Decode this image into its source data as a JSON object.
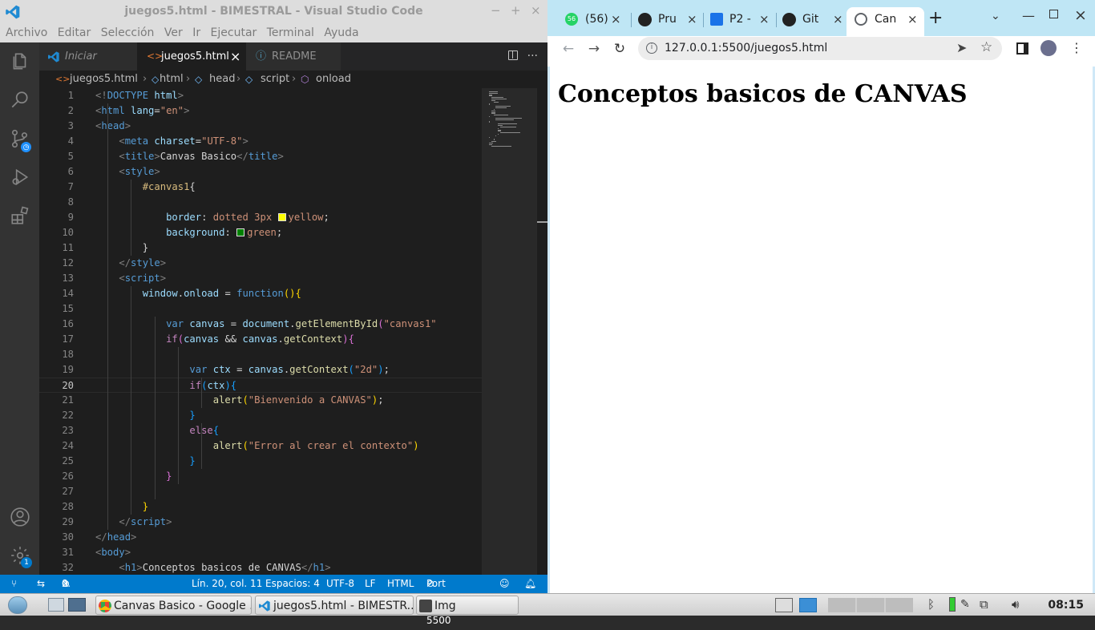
{
  "vscode": {
    "title": "juegos5.html - BIMESTRAL - Visual Studio Code",
    "window_controls": [
      "−",
      "+",
      "×"
    ],
    "menu": [
      "Archivo",
      "Editar",
      "Selección",
      "Ver",
      "Ir",
      "Ejecutar",
      "Terminal",
      "Ayuda"
    ],
    "tabs": [
      {
        "label": "Iniciar",
        "icon": "vscode-icon",
        "active": false
      },
      {
        "label": "juegos5.html",
        "icon": "html-icon",
        "active": true,
        "close": "×"
      },
      {
        "label": "README",
        "icon": "info-icon",
        "active": false
      }
    ],
    "tab_actions": {
      "split": "split-editor-icon",
      "more": "···"
    },
    "breadcrumb": [
      "juegos5.html",
      "html",
      "head",
      "script",
      "onload"
    ],
    "current_line": 20,
    "activity_badge": "1",
    "status": {
      "branch_icon": "remote-icon",
      "errors": "0",
      "warnings": "0",
      "position": "Lín. 20, col. 11",
      "spaces": "Espacios: 4",
      "encoding": "UTF-8",
      "eol": "LF",
      "language": "HTML",
      "port": "Port : 5500"
    }
  },
  "code_lines": [
    [
      {
        "t": "<!",
        "c": "t-tag"
      },
      {
        "t": "DOCTYPE",
        "c": "t-name"
      },
      {
        "t": " html",
        "c": "t-attr"
      },
      {
        "t": ">",
        "c": "t-tag"
      }
    ],
    [
      {
        "t": "<",
        "c": "t-tag"
      },
      {
        "t": "html",
        "c": "t-name"
      },
      {
        "t": " lang",
        "c": "t-attr"
      },
      {
        "t": "=",
        "c": "t-pun"
      },
      {
        "t": "\"en\"",
        "c": "t-str"
      },
      {
        "t": ">",
        "c": "t-tag"
      }
    ],
    [
      {
        "t": "<",
        "c": "t-tag"
      },
      {
        "t": "head",
        "c": "t-name"
      },
      {
        "t": ">",
        "c": "t-tag"
      }
    ],
    [
      {
        "t": "    "
      },
      {
        "t": "<",
        "c": "t-tag"
      },
      {
        "t": "meta",
        "c": "t-name"
      },
      {
        "t": " charset",
        "c": "t-attr"
      },
      {
        "t": "=",
        "c": "t-pun"
      },
      {
        "t": "\"UTF-8\"",
        "c": "t-str"
      },
      {
        "t": ">",
        "c": "t-tag"
      }
    ],
    [
      {
        "t": "    "
      },
      {
        "t": "<",
        "c": "t-tag"
      },
      {
        "t": "title",
        "c": "t-name"
      },
      {
        "t": ">",
        "c": "t-tag"
      },
      {
        "t": "Canvas Basico",
        "c": "t-pun"
      },
      {
        "t": "</",
        "c": "t-tag"
      },
      {
        "t": "title",
        "c": "t-name"
      },
      {
        "t": ">",
        "c": "t-tag"
      }
    ],
    [
      {
        "t": "    "
      },
      {
        "t": "<",
        "c": "t-tag"
      },
      {
        "t": "style",
        "c": "t-name"
      },
      {
        "t": ">",
        "c": "t-tag"
      }
    ],
    [
      {
        "t": "        "
      },
      {
        "t": "#canvas1",
        "c": "t-css-sel"
      },
      {
        "t": "{",
        "c": "t-pun"
      }
    ],
    [
      {
        "t": ""
      }
    ],
    [
      {
        "t": "            "
      },
      {
        "t": "border",
        "c": "t-css-prop"
      },
      {
        "t": ": ",
        "c": "t-pun"
      },
      {
        "t": "dotted 3px ",
        "c": "t-css-val"
      },
      {
        "sw": "#ffff00"
      },
      {
        "t": "yellow",
        "c": "t-css-val"
      },
      {
        "t": ";",
        "c": "t-pun"
      }
    ],
    [
      {
        "t": "            "
      },
      {
        "t": "background",
        "c": "t-css-prop"
      },
      {
        "t": ": ",
        "c": "t-pun"
      },
      {
        "sw": "#008000"
      },
      {
        "t": "green",
        "c": "t-css-val"
      },
      {
        "t": ";",
        "c": "t-pun"
      }
    ],
    [
      {
        "t": "        "
      },
      {
        "t": "}",
        "c": "t-pun"
      }
    ],
    [
      {
        "t": "    "
      },
      {
        "t": "</",
        "c": "t-tag"
      },
      {
        "t": "style",
        "c": "t-name"
      },
      {
        "t": ">",
        "c": "t-tag"
      }
    ],
    [
      {
        "t": "    "
      },
      {
        "t": "<",
        "c": "t-tag"
      },
      {
        "t": "script",
        "c": "t-name"
      },
      {
        "t": ">",
        "c": "t-tag"
      }
    ],
    [
      {
        "t": "        "
      },
      {
        "t": "window",
        "c": "t-var"
      },
      {
        "t": ".",
        "c": "t-pun"
      },
      {
        "t": "onload",
        "c": "t-var"
      },
      {
        "t": " = ",
        "c": "t-pun"
      },
      {
        "t": "function",
        "c": "t-kw"
      },
      {
        "t": "()",
        "c": "t-brk"
      },
      {
        "t": "{",
        "c": "t-brk"
      }
    ],
    [
      {
        "t": ""
      }
    ],
    [
      {
        "t": "            "
      },
      {
        "t": "var",
        "c": "t-kw"
      },
      {
        "t": " canvas",
        "c": "t-var"
      },
      {
        "t": " = ",
        "c": "t-pun"
      },
      {
        "t": "document",
        "c": "t-var"
      },
      {
        "t": ".",
        "c": "t-pun"
      },
      {
        "t": "getElementById",
        "c": "t-fn"
      },
      {
        "t": "(",
        "c": "t-brk2"
      },
      {
        "t": "\"canvas1\"",
        "c": "t-str"
      }
    ],
    [
      {
        "t": "            "
      },
      {
        "t": "if",
        "c": "t-ctrl"
      },
      {
        "t": "(",
        "c": "t-brk2"
      },
      {
        "t": "canvas",
        "c": "t-var"
      },
      {
        "t": " && ",
        "c": "t-pun"
      },
      {
        "t": "canvas",
        "c": "t-var"
      },
      {
        "t": ".",
        "c": "t-pun"
      },
      {
        "t": "getContext",
        "c": "t-fn"
      },
      {
        "t": ")",
        "c": "t-brk2"
      },
      {
        "t": "{",
        "c": "t-brk2"
      }
    ],
    [
      {
        "t": ""
      }
    ],
    [
      {
        "t": "                "
      },
      {
        "t": "var",
        "c": "t-kw"
      },
      {
        "t": " ctx",
        "c": "t-var"
      },
      {
        "t": " = ",
        "c": "t-pun"
      },
      {
        "t": "canvas",
        "c": "t-var"
      },
      {
        "t": ".",
        "c": "t-pun"
      },
      {
        "t": "getContext",
        "c": "t-fn"
      },
      {
        "t": "(",
        "c": "t-brk3"
      },
      {
        "t": "\"2d\"",
        "c": "t-str"
      },
      {
        "t": ")",
        "c": "t-brk3"
      },
      {
        "t": ";",
        "c": "t-pun"
      }
    ],
    [
      {
        "t": "                "
      },
      {
        "t": "if",
        "c": "t-ctrl"
      },
      {
        "t": "(",
        "c": "t-brk3"
      },
      {
        "t": "ctx",
        "c": "t-var"
      },
      {
        "t": ")",
        "c": "t-brk3"
      },
      {
        "t": "{",
        "c": "t-brk3"
      }
    ],
    [
      {
        "t": "                    "
      },
      {
        "t": "alert",
        "c": "t-fn"
      },
      {
        "t": "(",
        "c": "t-brk"
      },
      {
        "t": "\"Bienvenido a CANVAS\"",
        "c": "t-str"
      },
      {
        "t": ")",
        "c": "t-brk"
      },
      {
        "t": ";",
        "c": "t-pun"
      }
    ],
    [
      {
        "t": "                "
      },
      {
        "t": "}",
        "c": "t-brk3"
      }
    ],
    [
      {
        "t": "                "
      },
      {
        "t": "else",
        "c": "t-ctrl"
      },
      {
        "t": "{",
        "c": "t-brk3"
      }
    ],
    [
      {
        "t": "                    "
      },
      {
        "t": "alert",
        "c": "t-fn"
      },
      {
        "t": "(",
        "c": "t-brk"
      },
      {
        "t": "\"Error al crear el contexto\"",
        "c": "t-str"
      },
      {
        "t": ")",
        "c": "t-brk"
      }
    ],
    [
      {
        "t": "                "
      },
      {
        "t": "}",
        "c": "t-brk3"
      }
    ],
    [
      {
        "t": "            "
      },
      {
        "t": "}",
        "c": "t-brk2"
      }
    ],
    [
      {
        "t": ""
      }
    ],
    [
      {
        "t": "        "
      },
      {
        "t": "}",
        "c": "t-brk"
      }
    ],
    [
      {
        "t": "    "
      },
      {
        "t": "</",
        "c": "t-tag"
      },
      {
        "t": "script",
        "c": "t-name"
      },
      {
        "t": ">",
        "c": "t-tag"
      }
    ],
    [
      {
        "t": "</",
        "c": "t-tag"
      },
      {
        "t": "head",
        "c": "t-name"
      },
      {
        "t": ">",
        "c": "t-tag"
      }
    ],
    [
      {
        "t": "<",
        "c": "t-tag"
      },
      {
        "t": "body",
        "c": "t-name"
      },
      {
        "t": ">",
        "c": "t-tag"
      }
    ],
    [
      {
        "t": "    "
      },
      {
        "t": "<",
        "c": "t-tag"
      },
      {
        "t": "h1",
        "c": "t-name"
      },
      {
        "t": ">",
        "c": "t-tag"
      },
      {
        "t": "Conceptos basicos de CANVAS",
        "c": "t-pun"
      },
      {
        "t": "</",
        "c": "t-tag"
      },
      {
        "t": "h1",
        "c": "t-name"
      },
      {
        "t": ">",
        "c": "t-tag"
      }
    ]
  ],
  "chrome": {
    "tabs": [
      {
        "label": "(56)",
        "icon": "whatsapp-icon",
        "badge": "56",
        "close": "×"
      },
      {
        "label": "Pru",
        "icon": "github-icon",
        "close": "×"
      },
      {
        "label": "P2 -",
        "icon": "classroom-icon",
        "close": "×"
      },
      {
        "label": "Git",
        "icon": "github-icon",
        "close": "×"
      },
      {
        "label": "Can",
        "icon": "globe-icon",
        "close": "×",
        "active": true
      }
    ],
    "new_tab": "+",
    "url": "127.0.0.1:5500/juegos5.html",
    "page_heading": "Conceptos basicos de CANVAS"
  },
  "taskbar": {
    "items": [
      {
        "label": "Canvas Basico - Google ...",
        "icon": "chrome-icon"
      },
      {
        "label": "juegos5.html - BIMESTR...",
        "icon": "vscode-icon"
      },
      {
        "label": "Img",
        "icon": "folder-icon"
      }
    ],
    "clock": "08:15"
  },
  "colors": {
    "accent": "#007acc",
    "vs_bg": "#1e1e1e",
    "chrome_frame": "#bfe6f5"
  }
}
